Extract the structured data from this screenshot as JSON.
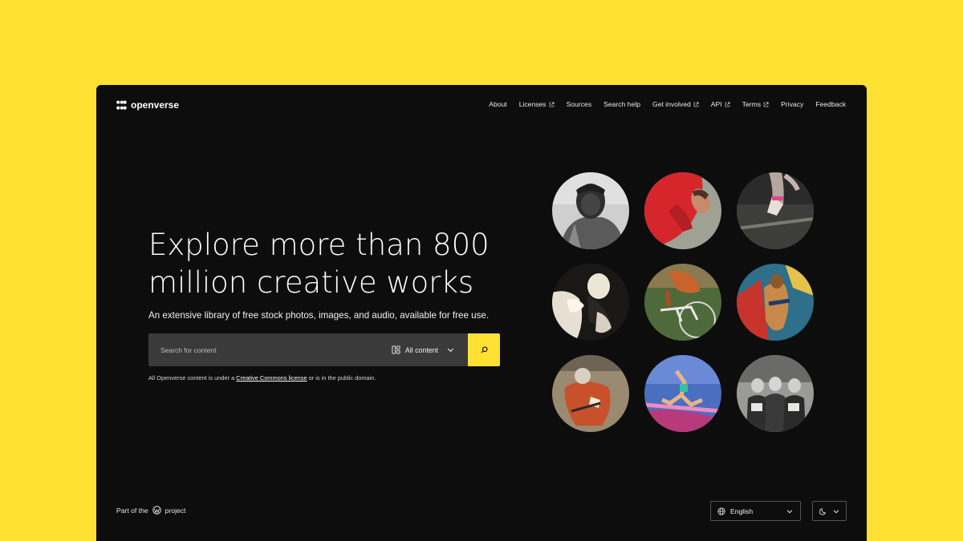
{
  "header": {
    "logo_text": "openverse",
    "nav": [
      {
        "label": "About",
        "external": false
      },
      {
        "label": "Licenses",
        "external": true
      },
      {
        "label": "Sources",
        "external": false
      },
      {
        "label": "Search help",
        "external": false
      },
      {
        "label": "Get involved",
        "external": true
      },
      {
        "label": "API",
        "external": true
      },
      {
        "label": "Terms",
        "external": true
      },
      {
        "label": "Privacy",
        "external": false
      },
      {
        "label": "Feedback",
        "external": false
      }
    ]
  },
  "hero": {
    "headline_line1": "Explore more than 800",
    "headline_line2": "million creative works",
    "subtitle": "An extensive library of free stock photos, images, and audio, available for free use."
  },
  "search": {
    "placeholder": "Search for content",
    "content_type": "All content",
    "content_type_icon": "grid-layout-icon",
    "button_icon": "search-icon"
  },
  "license_note": {
    "before": "All Openverse content is under a ",
    "link": "Creative Commons license",
    "after": " or is in the public domain."
  },
  "gallery": {
    "images": [
      {
        "subject": "athlete portrait black and white"
      },
      {
        "subject": "athlete in red shirt"
      },
      {
        "subject": "gymnast hands on bar"
      },
      {
        "subject": "boxers illustration"
      },
      {
        "subject": "cyclist on track bike"
      },
      {
        "subject": "illustrated athlete poster"
      },
      {
        "subject": "cyclist in orange jersey"
      },
      {
        "subject": "long jumper in motion"
      },
      {
        "subject": "vintage women athletes photo"
      }
    ]
  },
  "footer": {
    "part_of_before": "Part of the",
    "part_of_after": "project",
    "wordpress_icon": "wordpress-icon",
    "language": "English",
    "theme_icon": "moon-icon"
  },
  "colors": {
    "background": "#FFE033",
    "window": "#0d0d0d",
    "accent": "#FFE033",
    "search_field": "#3a3a3a"
  }
}
